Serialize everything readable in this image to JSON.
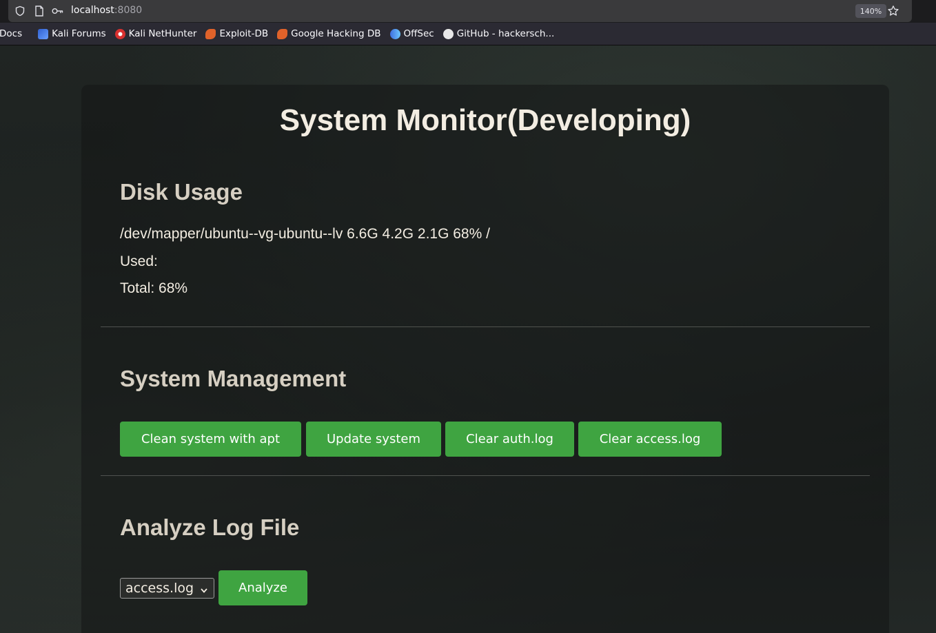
{
  "browser": {
    "url_host": "localhost",
    "url_port": ":8080",
    "zoom": "140%",
    "bookmarks": [
      {
        "label": "Docs",
        "icon": "docs-icon",
        "color": ""
      },
      {
        "label": "Kali Forums",
        "icon": "kali-forums-icon",
        "color": "#3a6fd8"
      },
      {
        "label": "Kali NetHunter",
        "icon": "kali-nethunter-icon",
        "color": "#d9302f"
      },
      {
        "label": "Exploit-DB",
        "icon": "exploit-db-icon",
        "color": "#e0622a"
      },
      {
        "label": "Google Hacking DB",
        "icon": "google-hacking-db-icon",
        "color": "#e0622a"
      },
      {
        "label": "OffSec",
        "icon": "offsec-icon",
        "color": "#3f6fe0"
      },
      {
        "label": "GitHub - hackersch...",
        "icon": "github-icon",
        "color": "#e8e8e8"
      }
    ]
  },
  "page": {
    "title": "System Monitor(Developing)",
    "disk": {
      "heading": "Disk Usage",
      "line": "/dev/mapper/ubuntu--vg-ubuntu--lv 6.6G 4.2G 2.1G 68% /",
      "used": "Used:",
      "total": "Total: 68%"
    },
    "management": {
      "heading": "System Management",
      "buttons": [
        "Clean system with apt",
        "Update system",
        "Clear auth.log",
        "Clear access.log"
      ]
    },
    "analyze": {
      "heading": "Analyze Log File",
      "selected": "access.log",
      "button": "Analyze"
    }
  },
  "colors": {
    "button_green": "#3fa441",
    "heading": "#d6cfc2",
    "text": "#f3ede2"
  }
}
